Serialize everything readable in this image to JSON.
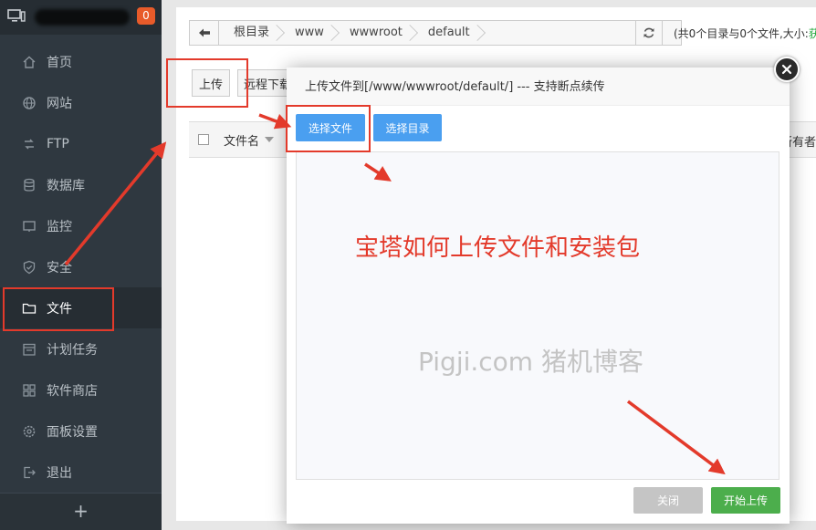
{
  "sidebar": {
    "notification_count": "0",
    "items": [
      {
        "label": "首页",
        "icon": "home-icon"
      },
      {
        "label": "网站",
        "icon": "globe-icon"
      },
      {
        "label": "FTP",
        "icon": "ftp-icon"
      },
      {
        "label": "数据库",
        "icon": "database-icon"
      },
      {
        "label": "监控",
        "icon": "monitor-icon"
      },
      {
        "label": "安全",
        "icon": "shield-icon"
      },
      {
        "label": "文件",
        "icon": "folder-icon"
      },
      {
        "label": "计划任务",
        "icon": "clock-icon"
      },
      {
        "label": "软件商店",
        "icon": "grid-icon"
      },
      {
        "label": "面板设置",
        "icon": "gear-icon"
      },
      {
        "label": "退出",
        "icon": "logout-icon"
      }
    ],
    "active_item": "文件",
    "add_label": "+"
  },
  "file_manager": {
    "breadcrumbs": [
      "根目录",
      "www",
      "wwwroot",
      "default"
    ],
    "path_info_prefix": "(共0个目录与0个文件,大小:",
    "path_info_size": "获",
    "upload_button": "上传",
    "remote_download_button": "远程下载",
    "columns": {
      "filename": "文件名",
      "owner": "所有者"
    }
  },
  "upload_dialog": {
    "title": "上传文件到[/www/wwwroot/default/] --- 支持断点续传",
    "select_file_button": "选择文件",
    "select_dir_button": "选择目录",
    "overlay_title": "宝塔如何上传文件和安装包",
    "watermark": "Pigji.com 猪机博客",
    "close_button": "关闭",
    "start_upload_button": "开始上传"
  },
  "colors": {
    "sidebar_bg": "#2f3840",
    "accent_blue": "#4a9ff0",
    "accent_green": "#4cae4c",
    "annotation_red": "#e33a2b"
  }
}
